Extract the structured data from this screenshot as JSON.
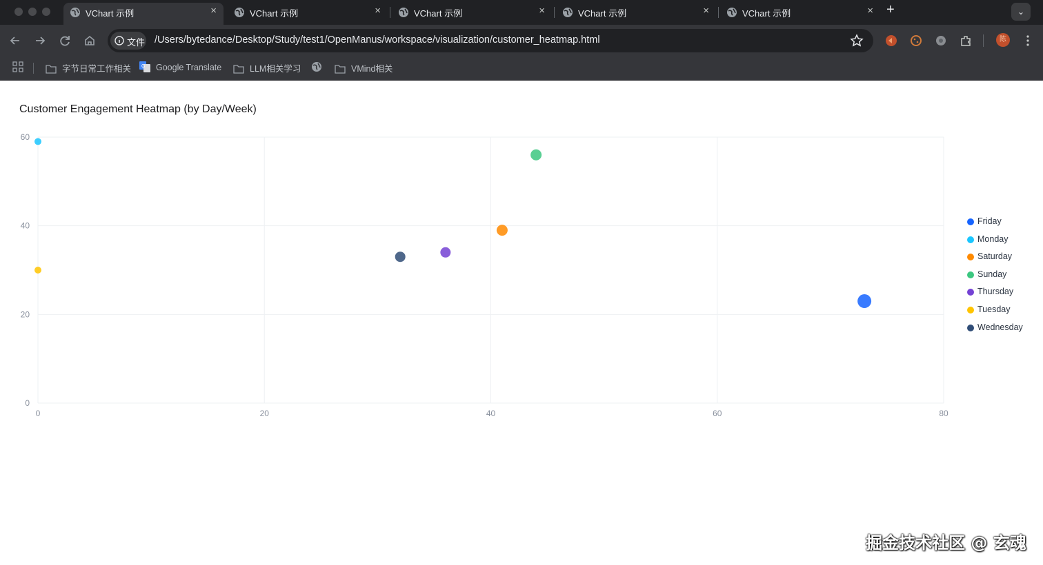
{
  "browser": {
    "tabs": [
      {
        "title": "VChart 示例",
        "active": true
      },
      {
        "title": "VChart 示例",
        "active": false
      },
      {
        "title": "VChart 示例",
        "active": false
      },
      {
        "title": "VChart 示例",
        "active": false
      },
      {
        "title": "VChart 示例",
        "active": false
      }
    ],
    "tab_close_glyph": "×",
    "new_tab_glyph": "+",
    "tab_menu_glyph": "⌄",
    "site_info_label": "文件",
    "url": "/Users/bytedance/Desktop/Study/test1/OpenManus/workspace/visualization/customer_heatmap.html",
    "bookmarks": [
      {
        "label": "",
        "icon": "apps-grid-icon"
      },
      {
        "label": "字节日常工作相关",
        "icon": "folder-icon"
      },
      {
        "label": "Google Translate",
        "icon": "google-translate-icon"
      },
      {
        "label": "LLM相关学习",
        "icon": "folder-icon"
      },
      {
        "label": "",
        "icon": "globe-icon"
      },
      {
        "label": "VMind相关",
        "icon": "folder-icon"
      }
    ],
    "profile_initial": "陈"
  },
  "chart_data": {
    "type": "scatter",
    "title": "Customer Engagement Heatmap (by Day/Week)",
    "xlim": [
      0,
      80
    ],
    "ylim": [
      0,
      60
    ],
    "x_ticks": [
      "0",
      "20",
      "40",
      "60",
      "80"
    ],
    "y_ticks": [
      "0",
      "20",
      "40",
      "60"
    ],
    "grid": true,
    "legend_position": "right",
    "series": [
      {
        "name": "Friday",
        "color": "#1664FF",
        "points": [
          {
            "x": 73,
            "y": 23,
            "size": 20
          }
        ]
      },
      {
        "name": "Monday",
        "color": "#1AC6FF",
        "points": [
          {
            "x": 0,
            "y": 59,
            "size": 10
          }
        ]
      },
      {
        "name": "Saturday",
        "color": "#FF8A00",
        "points": [
          {
            "x": 41,
            "y": 39,
            "size": 16
          }
        ]
      },
      {
        "name": "Sunday",
        "color": "#3CC780",
        "points": [
          {
            "x": 44,
            "y": 56,
            "size": 16
          }
        ]
      },
      {
        "name": "Thursday",
        "color": "#7442D4",
        "points": [
          {
            "x": 36,
            "y": 34,
            "size": 15
          }
        ]
      },
      {
        "name": "Tuesday",
        "color": "#FFC400",
        "points": [
          {
            "x": 0,
            "y": 30,
            "size": 10
          }
        ]
      },
      {
        "name": "Wednesday",
        "color": "#304D77",
        "points": [
          {
            "x": 32,
            "y": 33,
            "size": 15
          }
        ]
      }
    ]
  },
  "watermark": "掘金技术社区 @ 玄魂"
}
